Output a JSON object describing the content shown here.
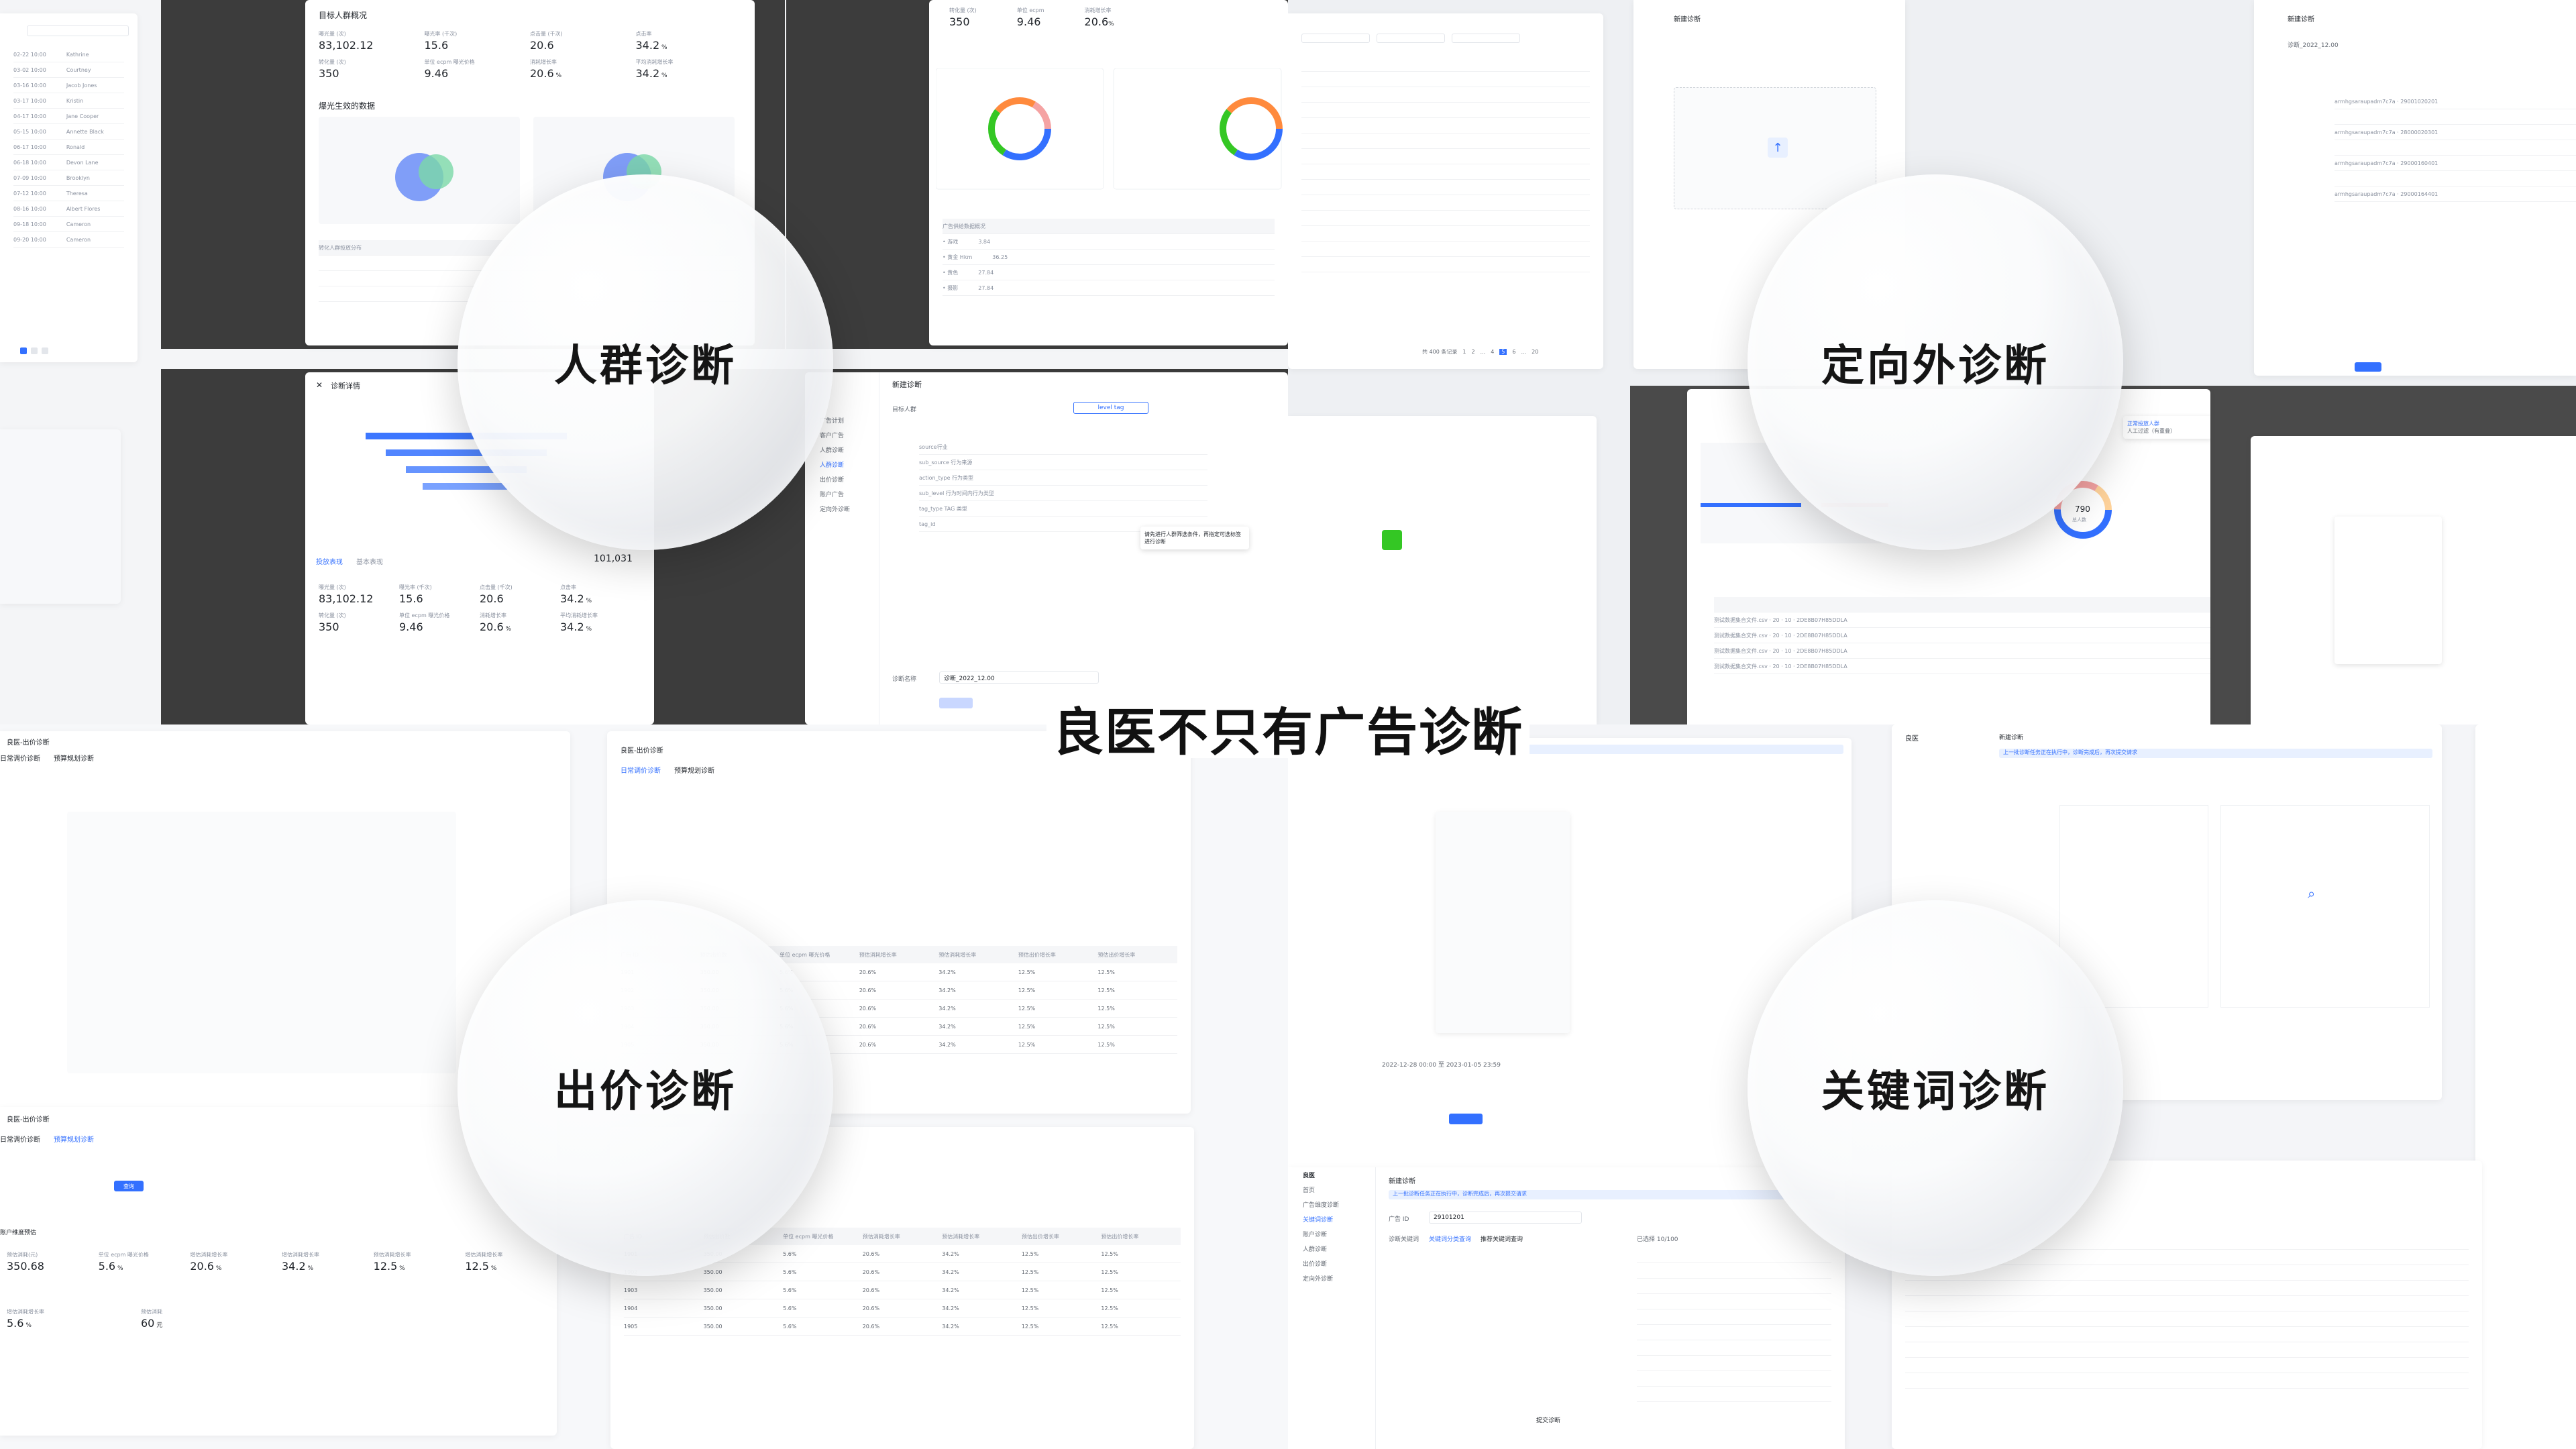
{
  "headline": "良医不只有广告诊断",
  "lenses": {
    "crowd": "人群诊断",
    "targeting": "定向外诊断",
    "bid": "出价诊断",
    "keyword": "关键词诊断"
  },
  "crowd_panel": {
    "title": "目标人群概况",
    "stats": [
      {
        "label": "曝光量 (次)",
        "value": "83,102.12"
      },
      {
        "label": "曝光率 (千次)",
        "value": "15.6"
      },
      {
        "label": "点击量 (千次)",
        "value": "20.6"
      },
      {
        "label": "点击率",
        "value": "34.2",
        "unit": "%"
      },
      {
        "label": "转化量 (次)",
        "value": "350"
      },
      {
        "label": "单位 ecpm 曝光价格",
        "value": "9.46"
      },
      {
        "label": "消耗增长率",
        "value": "20.6",
        "unit": "%"
      },
      {
        "label": "平均消耗增长率",
        "value": "34.2",
        "unit": "%"
      }
    ],
    "venn_title": "爆光生效的数据",
    "table_title": "转化人群投放分布",
    "table_right_title": "广告供给数据概况",
    "funnel_value": "101,031"
  },
  "diag_detail": {
    "close": "✕",
    "title": "诊断详情",
    "tabs": [
      "投放表现",
      "基本表现"
    ]
  },
  "new_diag": {
    "title": "新建诊断",
    "field_crowd": "目标人群",
    "field_name": "诊断名称",
    "name_value": "诊断_2022_12.00",
    "target_tag": "level tag",
    "tooltip": "请先进行人群筛选条件，再指定可选标签进行诊断"
  },
  "targeting": {
    "pagination": "共 400 条记录",
    "page_nums": [
      "1",
      "2",
      "...",
      "4",
      "5",
      "6",
      "...",
      "20"
    ],
    "donut_value": "790",
    "donut_label": "总人数",
    "legend": [
      "正常投放人群",
      "人工过滤（有重叠）"
    ]
  },
  "bid": {
    "header_title": "良医-出价诊断",
    "tabs": [
      "日常调价诊断",
      "预算规划诊断"
    ],
    "account_row": "账户维度预估",
    "query_button": "查询",
    "stats": [
      {
        "label": "预估消耗(元)",
        "value": "350.68"
      },
      {
        "label": "单位 ecpm 曝光价格",
        "value": "5.6",
        "unit": "%"
      },
      {
        "label": "增估消耗增长率",
        "value": "20.6",
        "unit": "%"
      },
      {
        "label": "增估消耗增长率",
        "value": "34.2",
        "unit": "%"
      },
      {
        "label": "预估消耗增长率",
        "value": "12.5",
        "unit": "%"
      },
      {
        "label": "增估消耗增长率",
        "value": "12.5",
        "unit": "%"
      }
    ],
    "second_stats": [
      {
        "label": "增估消耗增长率",
        "value": "5.6",
        "unit": "%"
      },
      {
        "label": "预估消耗",
        "value": "60",
        "unit": "元"
      }
    ],
    "table_header": [
      "广告 ID",
      "预估出价数",
      "单位 ecpm 曝光价格",
      "预估消耗增长率",
      "预估消耗增长率",
      "预估出价增长率",
      "预估出价增长率"
    ],
    "rows": [
      [
        "1901",
        "350.00",
        "5.6%",
        "20.6%",
        "34.2%",
        "12.5%",
        "12.5%"
      ],
      [
        "1902",
        "350.00",
        "5.6%",
        "20.6%",
        "34.2%",
        "12.5%",
        "12.5%"
      ],
      [
        "1903",
        "350.00",
        "5.6%",
        "20.6%",
        "34.2%",
        "12.5%",
        "12.5%"
      ],
      [
        "1904",
        "350.00",
        "5.6%",
        "20.6%",
        "34.2%",
        "12.5%",
        "12.5%"
      ],
      [
        "1905",
        "350.00",
        "5.6%",
        "20.6%",
        "34.2%",
        "12.5%",
        "12.5%"
      ]
    ]
  },
  "keyword": {
    "brand": "良医",
    "title": "新建诊断",
    "notice": "上一批诊断任务正在执行中，诊断完成后，再次提交请求",
    "field_ad": "广告 ID",
    "ad_value": "29101201",
    "field_kw": "诊断关键词",
    "tabs": [
      "关键词分类查询",
      "推荐关键词查询"
    ],
    "count": "已选择 10/100",
    "submit": "提交诊断",
    "date_range": "2022-12-28 00:00 至 2023-01-05 23:59"
  },
  "colors": {
    "accent": "#3370ff",
    "green": "#34c724",
    "pink": "#f5a3a3",
    "purple": "#a56bf5",
    "orange": "#ff8a3d"
  }
}
